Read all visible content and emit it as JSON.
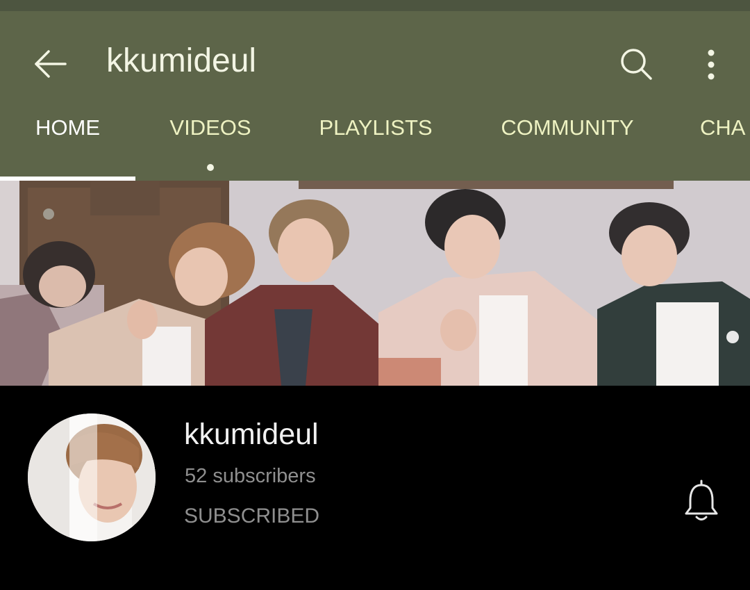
{
  "header": {
    "title": "kkumideul",
    "icons": {
      "back": "arrow-left-icon",
      "search": "search-icon",
      "more": "more-vert-icon"
    }
  },
  "tabs": [
    {
      "label": "HOME",
      "active": true
    },
    {
      "label": "VIDEOS",
      "active": false,
      "has_dot": true
    },
    {
      "label": "PLAYLISTS",
      "active": false
    },
    {
      "label": "COMMUNITY",
      "active": false
    },
    {
      "label": "CHA",
      "active": false
    }
  ],
  "channel": {
    "name": "kkumideul",
    "subscribers": "52 subscribers",
    "subscribe_state": "SUBSCRIBED",
    "bell_icon": "bell-icon"
  },
  "colors": {
    "appbar": "#5d6549",
    "statusbar": "#4d5540",
    "tab_text": "#eef2c2",
    "active_tab": "#ffffff",
    "background": "#000000",
    "muted_text": "#8f8f8f"
  }
}
